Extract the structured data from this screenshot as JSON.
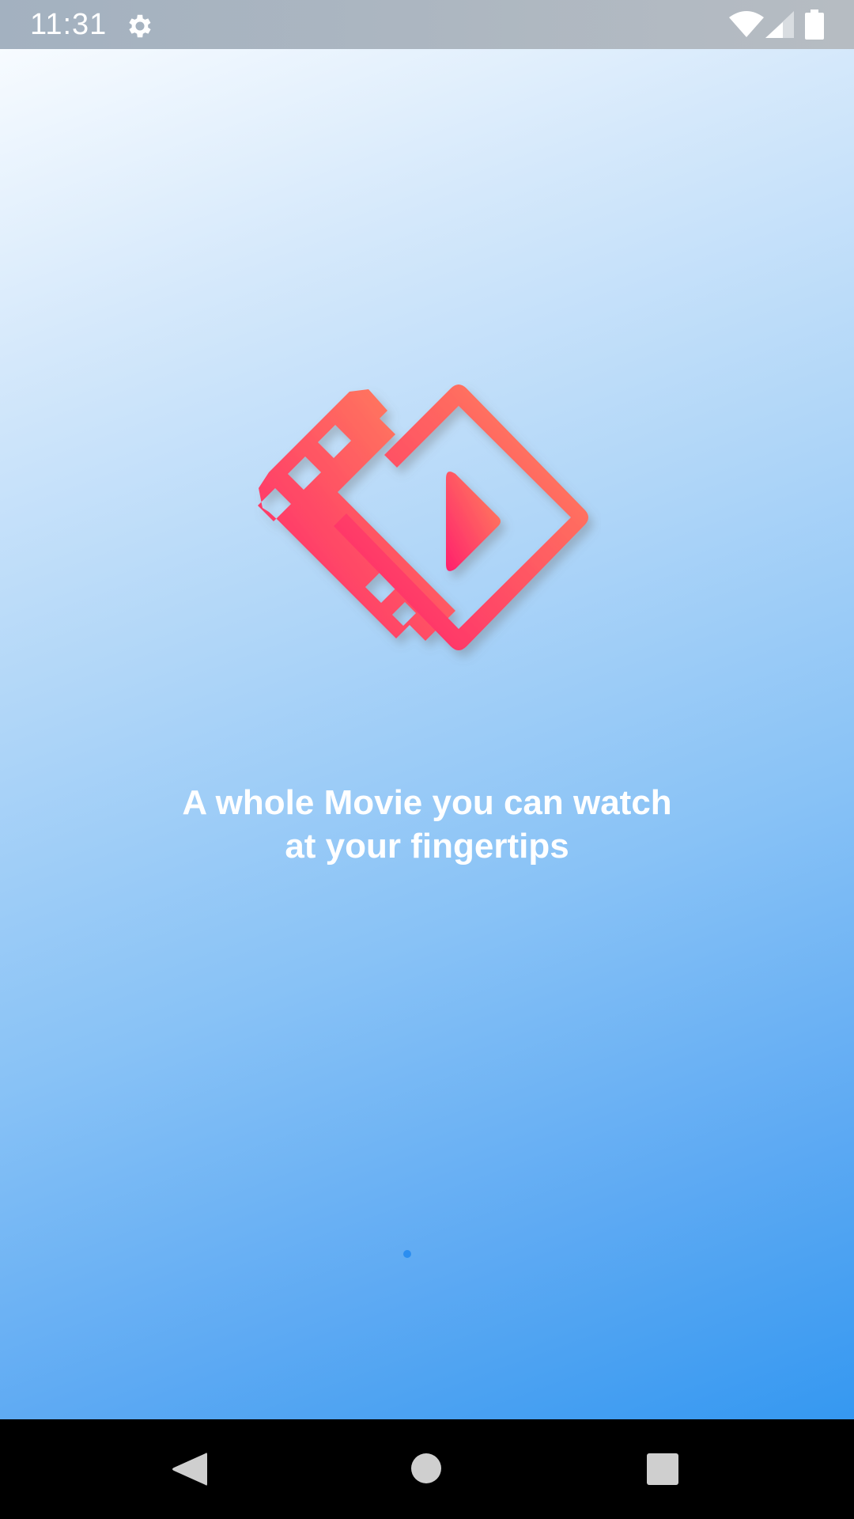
{
  "status_bar": {
    "time": "11:31",
    "icons": [
      "gear-icon",
      "wifi-icon",
      "signal-icon",
      "battery-icon"
    ]
  },
  "splash": {
    "logo_icon": "film-play-icon",
    "tagline_line1": "A whole Movie you can watch",
    "tagline_line2": "at your fingertips",
    "page_indicator": {
      "current": 1
    }
  },
  "nav_bar": {
    "buttons": [
      "back-icon",
      "home-icon",
      "recents-icon"
    ]
  },
  "colors": {
    "logo_gradient_start": "#ff1f6d",
    "logo_gradient_end": "#ff8a5b",
    "background_top": "#f7fbff",
    "background_bottom": "#3598f1",
    "text": "#ffffff"
  }
}
